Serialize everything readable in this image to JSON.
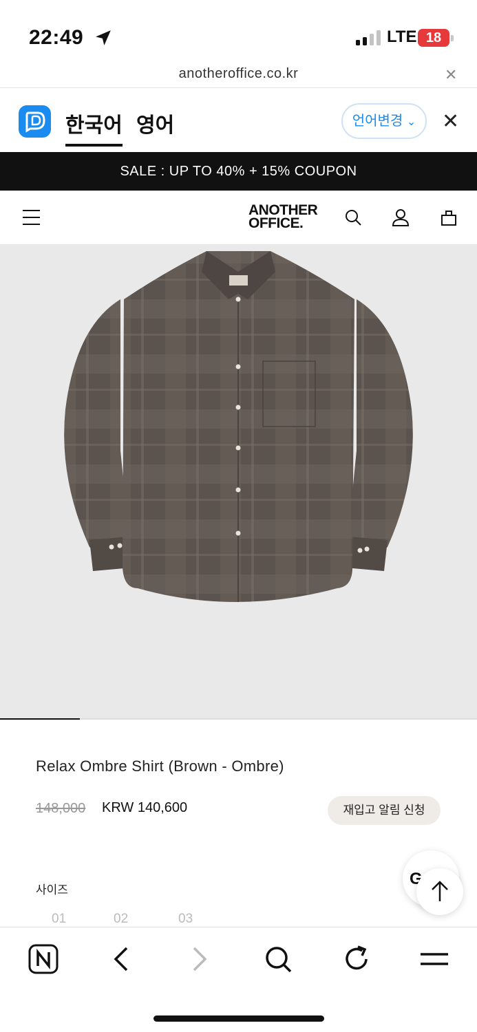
{
  "status_bar": {
    "time": "22:49",
    "network": "LTE",
    "battery": "18"
  },
  "url_bar": {
    "url": "anotheroffice.co.kr"
  },
  "translate_bar": {
    "source_lang": "한국어",
    "target_lang": "영어",
    "change_label": "언어변경"
  },
  "banner": {
    "text": "SALE : UP TO 40% + 15% COUPON"
  },
  "header": {
    "logo_line1": "ANOTHER",
    "logo_line2": "OFFICE."
  },
  "product": {
    "name": "Relax Ombre Shirt (Brown - Ombre)",
    "original_price": "148,000",
    "sale_price": "KRW 140,600",
    "restock_label": "재입고 알림 신청",
    "size_label": "사이즈",
    "sizes": [
      "01",
      "02",
      "03"
    ],
    "image_color": "#5e5650"
  },
  "floating": {
    "chat_label": "G"
  },
  "colors": {
    "accent": "#1a8cf0",
    "banner_bg": "#111111",
    "battery": "#e5393b"
  }
}
